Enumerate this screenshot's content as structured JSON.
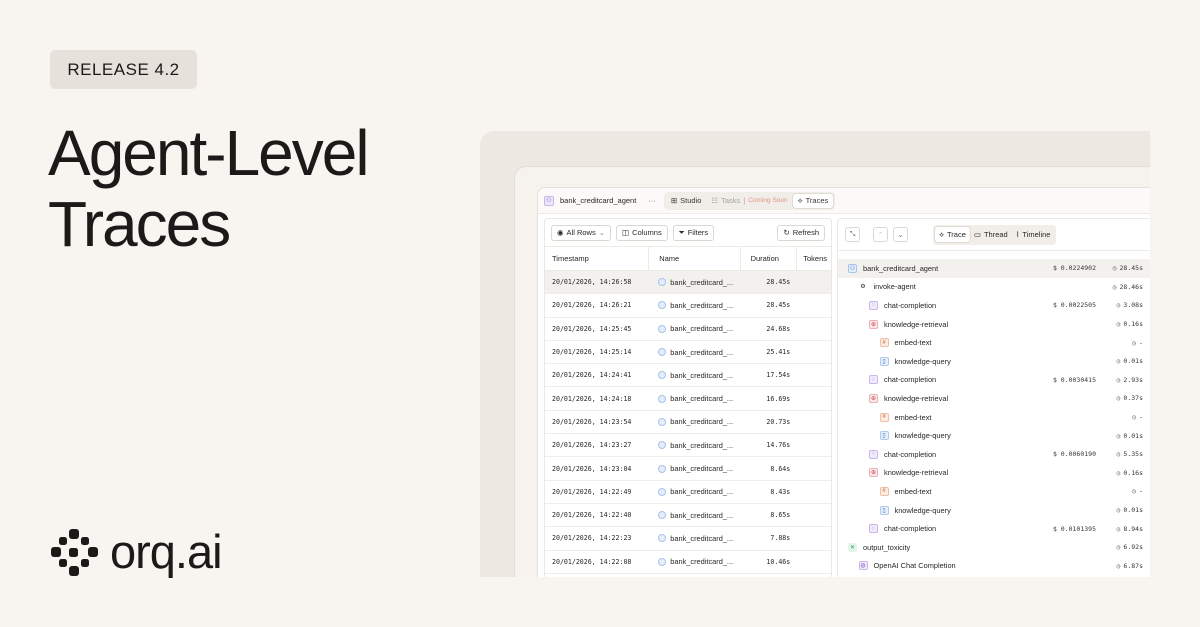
{
  "badge": "RELEASE 4.2",
  "headline": {
    "line1": "Agent-Level",
    "line2": "Traces"
  },
  "brand": "orq.ai",
  "app": {
    "agent_name": "bank_creditcard_agent",
    "more": "···",
    "tabs": [
      {
        "label": "Studio",
        "icon": "grid-icon"
      },
      {
        "label": "Tasks",
        "icon": "list-icon",
        "suffix": "Coming Soon"
      },
      {
        "label": "Traces",
        "icon": "traces-icon"
      }
    ],
    "toolbar": {
      "rows": "All Rows",
      "columns": "Columns",
      "filters": "Filters",
      "refresh": "Refresh"
    },
    "columns": [
      "Timestamp",
      "Name",
      "Duration",
      "Tokens"
    ],
    "rows": [
      {
        "ts": "20/01/2026, 14:26:58",
        "name": "bank_creditcard_...",
        "dur": "28.45s"
      },
      {
        "ts": "20/01/2026, 14:26:21",
        "name": "bank_creditcard_...",
        "dur": "28.45s"
      },
      {
        "ts": "20/01/2026, 14:25:45",
        "name": "bank_creditcard_...",
        "dur": "24.68s"
      },
      {
        "ts": "20/01/2026, 14:25:14",
        "name": "bank_creditcard_...",
        "dur": "25.41s"
      },
      {
        "ts": "20/01/2026, 14:24:41",
        "name": "bank_creditcard_...",
        "dur": "17.54s"
      },
      {
        "ts": "20/01/2026, 14:24:18",
        "name": "bank_creditcard_...",
        "dur": "16.69s"
      },
      {
        "ts": "20/01/2026, 14:23:54",
        "name": "bank_creditcard_...",
        "dur": "20.73s"
      },
      {
        "ts": "20/01/2026, 14:23:27",
        "name": "bank_creditcard_...",
        "dur": "14.76s"
      },
      {
        "ts": "20/01/2026, 14:23:04",
        "name": "bank_creditcard_...",
        "dur": "8.64s"
      },
      {
        "ts": "20/01/2026, 14:22:49",
        "name": "bank_creditcard_...",
        "dur": "8.43s"
      },
      {
        "ts": "20/01/2026, 14:22:40",
        "name": "bank_creditcard_...",
        "dur": "8.65s"
      },
      {
        "ts": "20/01/2026, 14:22:23",
        "name": "bank_creditcard_...",
        "dur": "7.88s"
      },
      {
        "ts": "20/01/2026, 14:22:08",
        "name": "bank_creditcard_...",
        "dur": "10.46s"
      }
    ],
    "views": [
      {
        "label": "Trace",
        "icon": "trace-icon"
      },
      {
        "label": "Thread",
        "icon": "thread-icon"
      },
      {
        "label": "Timeline",
        "icon": "timeline-icon"
      }
    ],
    "tree": [
      {
        "label": "bank_creditcard_agent",
        "cost": "$ 0.0224902",
        "dur": "28.45s",
        "kind": "agent"
      },
      {
        "label": "invoke-agent",
        "cost": "",
        "dur": "28.46s",
        "kind": "invoke"
      },
      {
        "label": "chat-completion",
        "cost": "$ 0.0022505",
        "dur": "3.08s",
        "kind": "chat"
      },
      {
        "label": "knowledge-retrieval",
        "cost": "",
        "dur": "0.16s",
        "kind": "knowledge"
      },
      {
        "label": "embed-text",
        "cost": "",
        "dur": "-",
        "kind": "embed"
      },
      {
        "label": "knowledge-query",
        "cost": "",
        "dur": "0.01s",
        "kind": "query"
      },
      {
        "label": "chat-completion",
        "cost": "$ 0.0030415",
        "dur": "2.93s",
        "kind": "chat"
      },
      {
        "label": "knowledge-retrieval",
        "cost": "",
        "dur": "0.37s",
        "kind": "knowledge"
      },
      {
        "label": "embed-text",
        "cost": "",
        "dur": "-",
        "kind": "embed"
      },
      {
        "label": "knowledge-query",
        "cost": "",
        "dur": "0.01s",
        "kind": "query"
      },
      {
        "label": "chat-completion",
        "cost": "$ 0.0060190",
        "dur": "5.35s",
        "kind": "chat"
      },
      {
        "label": "knowledge-retrieval",
        "cost": "",
        "dur": "0.16s",
        "kind": "knowledge"
      },
      {
        "label": "embed-text",
        "cost": "",
        "dur": "-",
        "kind": "embed"
      },
      {
        "label": "knowledge-query",
        "cost": "",
        "dur": "0.01s",
        "kind": "query"
      },
      {
        "label": "chat-completion",
        "cost": "$ 0.0101395",
        "dur": "8.94s",
        "kind": "chat"
      },
      {
        "label": "output_toxicity",
        "cost": "",
        "dur": "6.92s",
        "kind": "eval"
      },
      {
        "label": "OpenAI Chat Completion",
        "cost": "",
        "dur": "6.87s",
        "kind": "openai"
      }
    ]
  }
}
